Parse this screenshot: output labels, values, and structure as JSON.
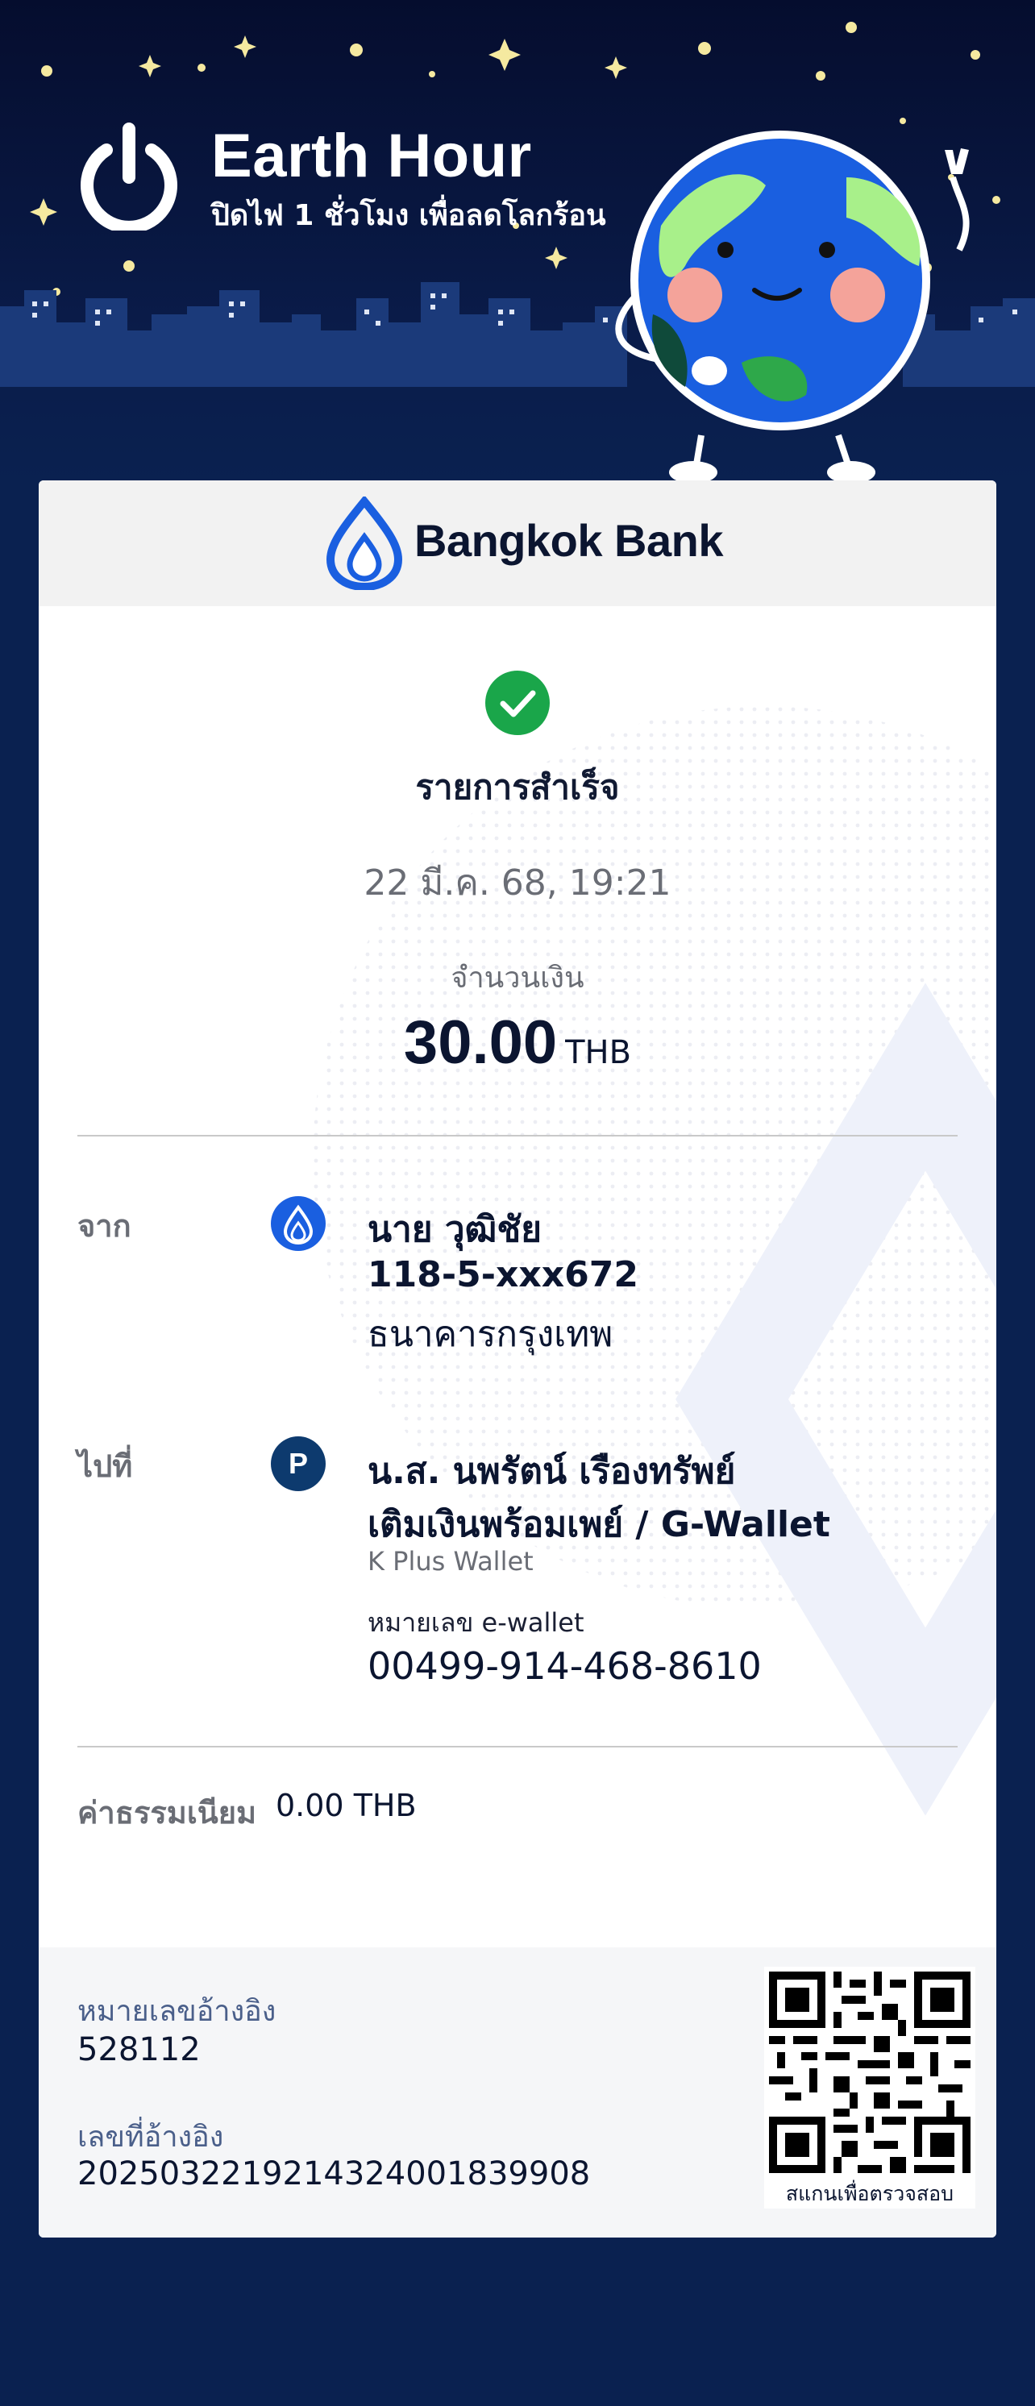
{
  "banner": {
    "title": "Earth Hour",
    "subtitle": "ปิดไฟ 1 ชั่วโมง เพื่อลดโลกร้อน"
  },
  "bank": {
    "name": "Bangkok Bank",
    "brand_color": "#1a5fe0"
  },
  "receipt": {
    "status": "รายการสำเร็จ",
    "datetime": "22 มี.ค. 68, 19:21",
    "amount_label": "จำนวนเงิน",
    "amount": "30.00",
    "currency": "THB"
  },
  "from": {
    "label": "จาก",
    "name": "นาย วุฒิชัย",
    "account": "118-5-xxx672",
    "bank": "ธนาคารกรุงเทพ",
    "icon": "bangkok-bank-icon"
  },
  "to": {
    "label": "ไปที่",
    "name": "น.ส. นพรัตน์ เรืองทรัพย์",
    "service": "เติมเงินพร้อมเพย์ / G-Wallet",
    "provider": "K Plus Wallet",
    "wallet_label": "หมายเลข e-wallet",
    "wallet_number": "00499-914-468-8610",
    "icon": "promptpay-icon",
    "icon_letter": "P"
  },
  "fee": {
    "label": "ค่าธรรมเนียม",
    "value": "0.00 THB"
  },
  "reference": {
    "ref1_label": "หมายเลขอ้างอิง",
    "ref1_value": "528112",
    "ref2_label": "เลขที่อ้างอิง",
    "ref2_value": "2025032219214324001839908",
    "qr_caption": "สแกนเพื่อตรวจสอบ"
  }
}
